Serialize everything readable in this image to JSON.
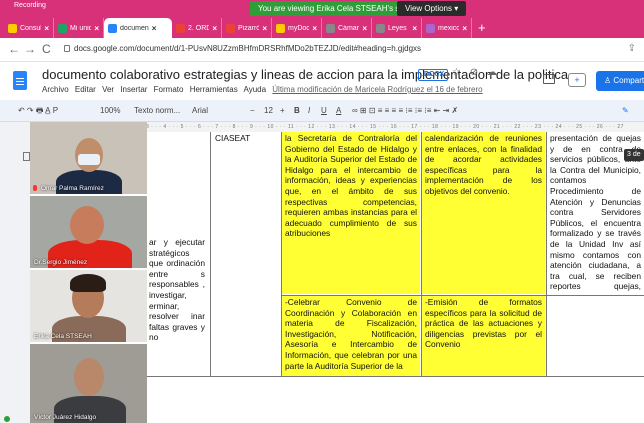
{
  "browser": {
    "recording_label": "Recording",
    "viewing_banner": "You are viewing Erika Cela STSEAH's screen",
    "view_options": "View Options ▾",
    "tabs": [
      {
        "label": "Consultar",
        "fav": "#ffcc00",
        "active": false
      },
      {
        "label": "Mi unidad",
        "fav": "#1fa463",
        "active": false
      },
      {
        "label": "documen",
        "fav": "#2684fc",
        "active": true
      },
      {
        "label": "2. ORDE",
        "fav": "#ea4335",
        "active": false
      },
      {
        "label": "Pizarrón",
        "fav": "#ea4335",
        "active": false
      },
      {
        "label": "myDocum",
        "fav": "#ffcc00",
        "active": false
      },
      {
        "label": "Cámara d",
        "fav": "#888888",
        "active": false
      },
      {
        "label": "Leyes Fed",
        "fav": "#888888",
        "active": false
      },
      {
        "label": "mexico1_",
        "fav": "#aa66cc",
        "active": false
      }
    ],
    "new_tab": "+",
    "url": "docs.google.com/document/d/1-PUsvN8UZzmBHfmDRSRhfMDo2bTEZJD/edit#heading=h.gjdgxs"
  },
  "doc": {
    "title": "documento colaborativo estrategias y lineas de accion para la implementacion de la politica",
    "badge": ".DOCX",
    "title_icons": "☆ ⊘ ☁",
    "menu": [
      "Archivo",
      "Editar",
      "Ver",
      "Insertar",
      "Formato",
      "Herramientas",
      "Ayuda"
    ],
    "last_edit": "Última modificación de Maricela Rodríguez el 16 de febrero",
    "meet_label": "+",
    "share_label": "Compartir"
  },
  "toolbar": {
    "icons": "↶ ↷ 🖶 A̲ P",
    "zoom": "100%",
    "style": "Texto norm...",
    "font": "Arial",
    "size_minus": "−",
    "size": "12",
    "size_plus": "+",
    "bold": "B",
    "italic": "I",
    "underline": "U",
    "color": "A",
    "right_icons": "∞ ⊞ ⊡ ≡ ≡ ≡ ≡ ⁝≡ ⁝≡ ⁝≡ ⇤ ⇥ ✗",
    "edit_icon": "✎"
  },
  "ruler": "3 · · · 4 · · · 5 · · · 6 · · · 7 · · · 8 · · · 9 · · · 10 · · · 11 · · · 12 · · · 13 · · · 14 · · · 15 · · · 16 · · · 17 · · · 18 · · · 19 · · · 20 · · · 21 · · · 22 · · · 23 · · · 24 · · · 25 · · · 26 · · · 27",
  "page_count": "3 de",
  "table": {
    "col1_row1": "ar y ejecutar stratégicos que ordinación entre s responsables , investigar, erminar, resolver inar faltas graves y no",
    "col2_top": "CIASEAT",
    "col3_row1": "la Secretaría de Contraloría del Gobierno del Estado de Hidalgo y la Auditoría Superior del Estado de Hidalgo para el intercambio de información, ideas y experiencias que, en el ámbito de sus respectivas competencias, requieren ambas instancias para el adecuado cumplimiento de sus atribuciones",
    "col4_row1": "calendarización de reuniones entre enlaces, con la finalidad de acordar actividades específicas para la implementación de los objetivos del convenio.",
    "col5_row1": "presentación de quejas y de en contra de servicios públicos, ante la Contra del Municipio, contamos Procedimiento de Atención y Denuncias contra Servidores Públicos, el encuentra formalizado y se través de la Unidad Inv así mismo contamos con atención ciudadana, a tra cual, se reciben reportes quejas, sugerencias, feli solicitud de información, s servicio y comentarios",
    "col3_row2": "-Celebrar Convenio de Coordinación y Colaboración en materia de Fiscalización, Investigación, Notificación, Asesoría e Intercambio de Información, que celebran por una parte la Auditoría Superior de la",
    "col4_row2": "-Emisión de formatos específicos para la solicitud de práctica de las actuaciones y diligencias previstas por el Convenio"
  },
  "participants": [
    {
      "name": "Omar Palma Ramírez"
    },
    {
      "name": "Dr.Sergio Jiménez"
    },
    {
      "name": "Erika Cela STSEAH"
    },
    {
      "name": "Víctor Juárez Hidalgo"
    }
  ],
  "colors": {
    "tabbar": "#d9307a",
    "highlight": "#ffff33",
    "accent": "#1a73e8"
  }
}
